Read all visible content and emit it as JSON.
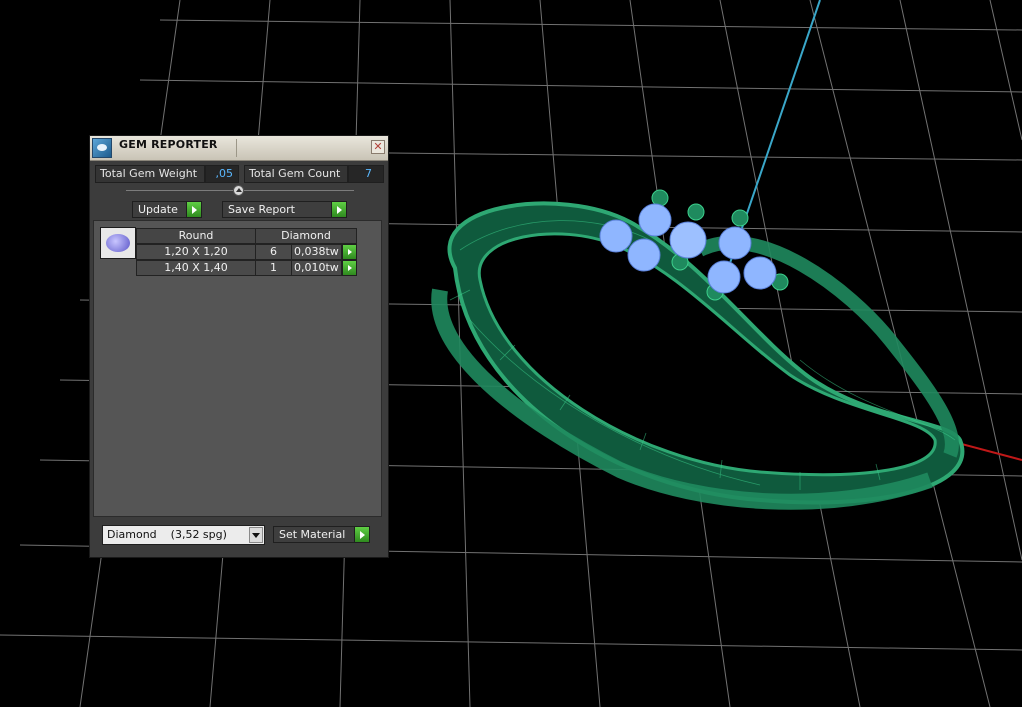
{
  "window": {
    "title": "GEM REPORTER",
    "close_glyph": "✕",
    "icon": "gem-reporter-app-icon"
  },
  "totals": {
    "weight_label": "Total Gem Weight",
    "weight_value": ",05",
    "count_label": "Total Gem Count",
    "count_value": "7"
  },
  "buttons": {
    "update": "Update",
    "save_report": "Save Report",
    "set_material": "Set Material"
  },
  "table": {
    "headers": [
      "Round",
      "Diamond"
    ],
    "rows": [
      {
        "size": "1,20 X 1,20",
        "count": "6",
        "weight": "0,038tw"
      },
      {
        "size": "1,40 X 1,40",
        "count": "1",
        "weight": "0,010tw"
      }
    ]
  },
  "material": {
    "selected": "Diamond    (3,52 spg)"
  },
  "viewport": {
    "scene": "3d-ring-wireframe",
    "colors": {
      "background": "#000000",
      "grid": "#d8d8d8",
      "ring": "#1f8a5e",
      "gems": "#8fb6ff",
      "y_axis": "#3aa7c9",
      "x_axis": "#c01818"
    }
  }
}
